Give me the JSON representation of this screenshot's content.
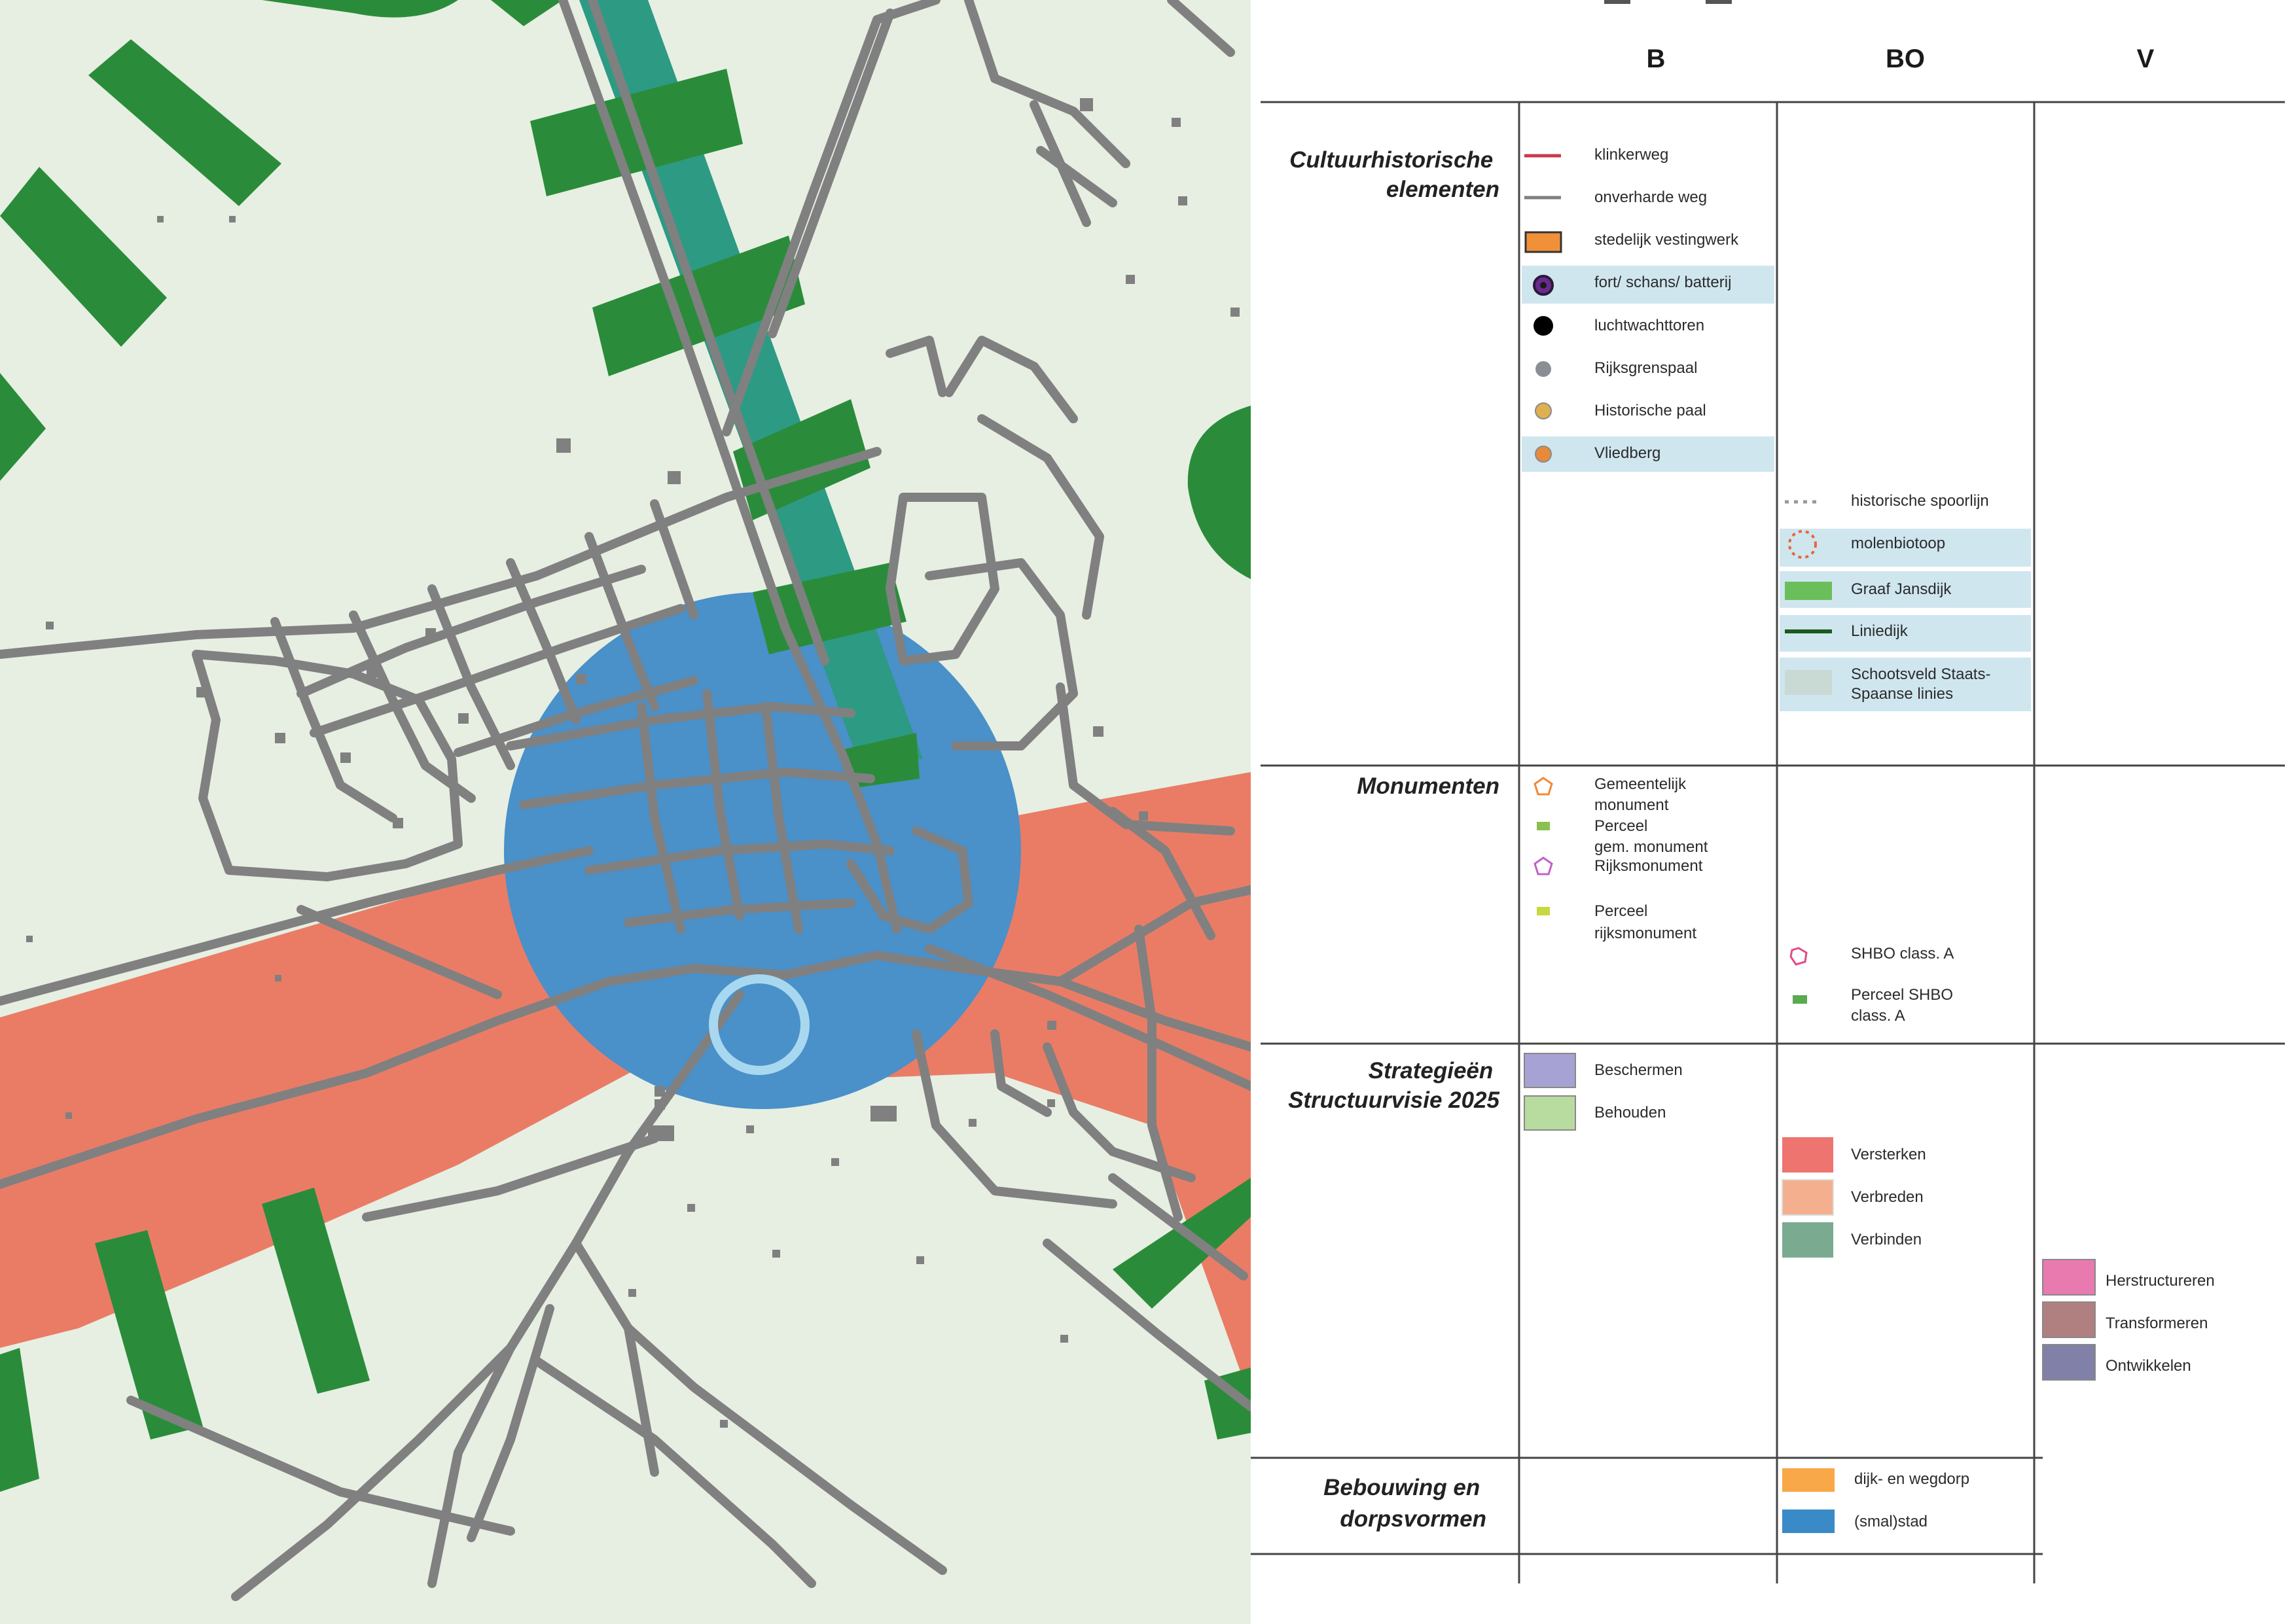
{
  "map": {
    "colors": {
      "background": "#e6efe2",
      "road": "#808080",
      "forest": "#2a8c3a",
      "salmon_zone": "#ea7c66",
      "blue_zone": "#4a90c9",
      "teal_strip": "#2d9a84",
      "highlight_circle": "#a8d8f0"
    }
  },
  "legend": {
    "columns": [
      "B",
      "BO",
      "V"
    ],
    "categories": [
      {
        "label": "Cultuurhistorische\nelementen",
        "key": "cultuurhistorische"
      },
      {
        "label": "Monumenten",
        "key": "monumenten"
      },
      {
        "label": "Strategieën\nStructuurvisie 2025",
        "key": "strategieen"
      },
      {
        "label": "Bebouwing en\ndorpsvormen",
        "key": "bebouwing"
      }
    ],
    "items": {
      "klinkerweg": "klinkerweg",
      "onverharde_weg": "onverharde weg",
      "stedelijk_vestingwerk": "stedelijk vestingwerk",
      "fort_schans_batterij": "fort/ schans/ batterij",
      "luchtwachttoren": "luchtwachttoren",
      "rijksgrenspaal": "Rijksgrenspaal",
      "historische_paal": "Historische paal",
      "vliedberg": "Vliedberg",
      "historische_spoorlijn": "historische spoorlijn",
      "molenbiotoop": "molenbiotoop",
      "graaf_jansdijk": "Graaf Jansdijk",
      "liniedijk": "Liniedijk",
      "schootsveld_line1": "Schootsveld Staats-",
      "schootsveld_line2": "Spaanse linies",
      "gemeentelijk_monument_line1": "Gemeentelijk",
      "gemeentelijk_monument_line2": "monument",
      "perceel_gem_line1": "Perceel",
      "perceel_gem_line2": "gem. monument",
      "rijksmonument": "Rijksmonument",
      "perceel_rijks_line1": "Perceel",
      "perceel_rijks_line2": "rijksmonument",
      "shbo_class_a": "SHBO class. A",
      "perceel_shbo_line1": "Perceel SHBO",
      "perceel_shbo_line2": "class. A",
      "beschermen": "Beschermen",
      "behouden": "Behouden",
      "versterken": "Versterken",
      "verbreden": "Verbreden",
      "verbinden": "Verbinden",
      "herstructureren": "Herstructureren",
      "transformeren": "Transformeren",
      "ontwikkelen": "Ontwikkelen",
      "dijk_en_wegdorp": "dijk- en wegdorp",
      "smal_stad": "(smal)stad"
    },
    "colors": {
      "klinkerweg": "#c8384c",
      "onverharde_weg": "#808080",
      "vestingwerk": "#f0913a",
      "fort": "#6a2a8c",
      "luchtwachttoren": "#000000",
      "rijksgrenspaal": "#8a8f96",
      "historische_paal": "#e0b050",
      "vliedberg": "#e88a3a",
      "highlight_row": "#cfe6ef",
      "molenbiotoop": "#e8663a",
      "graaf_jansdijk": "#6abf5a",
      "liniedijk": "#1a5a1a",
      "schootsveld": "#c9d9d4",
      "gemeentelijk_monument": "#f08a3a",
      "perceel_gem": "#8ac050",
      "rijksmonument": "#c060c8",
      "perceel_rijks": "#c8d840",
      "shbo": "#e04a8a",
      "perceel_shbo": "#5aaa50",
      "beschermen": "#a7a2d4",
      "behouden": "#b8dba0",
      "versterken": "#ee7470",
      "verbreden": "#f4b08e",
      "verbinden": "#7aab90",
      "herstructureren": "#e87ab0",
      "transformeren": "#b08080",
      "ontwikkelen": "#8080a8",
      "dijk_en_wegdorp": "#f8a848",
      "smal_stad": "#3a8ac8"
    }
  }
}
